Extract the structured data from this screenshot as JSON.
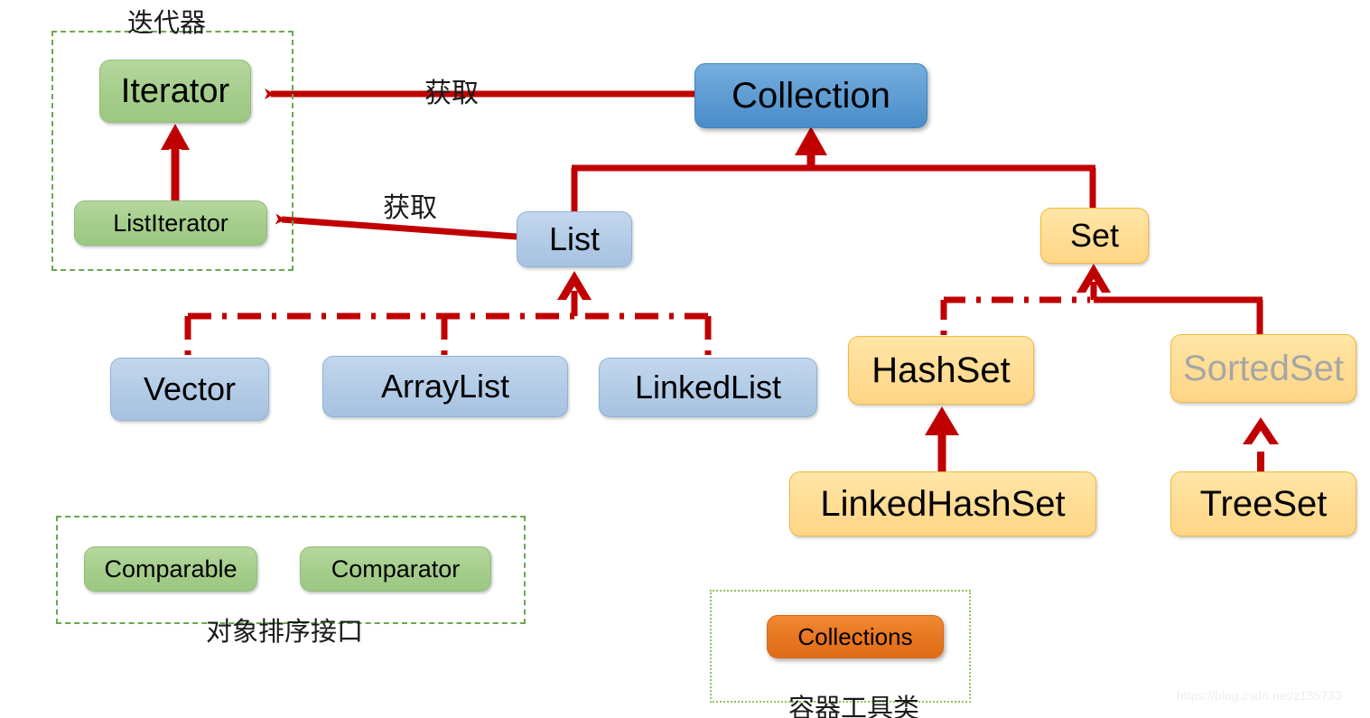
{
  "diagram": {
    "title_watermark": "https://blog.csdn.net/z135733",
    "colors": {
      "arrow_red": "#c00000",
      "green_node": "#a4cd8a",
      "blue_dark_node": "#5f9dd4",
      "blue_light_node": "#b2cbe6",
      "yellow_node": "#ffdc93",
      "orange_node": "#e87722",
      "group_border_green": "#6aa84f",
      "group_border_dotted": "#8fc45a",
      "muted_text": "#a6a6a6"
    }
  },
  "nodes": {
    "iterator": {
      "label": "Iterator"
    },
    "list_iterator": {
      "label": "ListIterator"
    },
    "collection": {
      "label": "Collection"
    },
    "list": {
      "label": "List"
    },
    "set": {
      "label": "Set"
    },
    "vector": {
      "label": "Vector"
    },
    "array_list": {
      "label": "ArrayList"
    },
    "linked_list": {
      "label": "LinkedList"
    },
    "hash_set": {
      "label": "HashSet"
    },
    "sorted_set": {
      "label": "SortedSet"
    },
    "linked_hash_set": {
      "label": "LinkedHashSet"
    },
    "tree_set": {
      "label": "TreeSet"
    },
    "comparable": {
      "label": "Comparable"
    },
    "comparator": {
      "label": "Comparator"
    },
    "collections": {
      "label": "Collections"
    }
  },
  "groups": {
    "iterator_group": {
      "label": "迭代器"
    },
    "sorting_group": {
      "label": "对象排序接口"
    },
    "utility_group": {
      "label": "容器工具类"
    }
  },
  "edge_labels": {
    "collection_to_iterator": "获取",
    "list_to_listiterator": "获取"
  }
}
